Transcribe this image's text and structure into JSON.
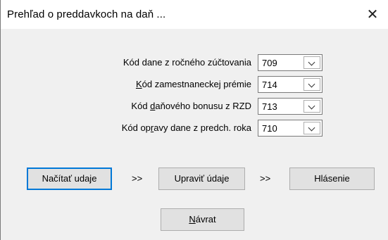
{
  "window": {
    "title": "Prehľad o preddavkoch na daň ...",
    "close_glyph": "✕"
  },
  "fields": [
    {
      "label_pre": "Kód dane z ročného zúčtovania",
      "label_acc": "",
      "label_post": "",
      "value": "709"
    },
    {
      "label_pre": "",
      "label_acc": "K",
      "label_post": "ód zamestnaneckej prémie",
      "value": "714"
    },
    {
      "label_pre": "Kód ",
      "label_acc": "d",
      "label_post": "aňového bonusu z RZD",
      "value": "713"
    },
    {
      "label_pre": "Kód op",
      "label_acc": "r",
      "label_post": "avy dane z predch. roka",
      "value": "710"
    }
  ],
  "actions": {
    "load_label": "Načítať udaje",
    "separator": ">>",
    "edit_label": "Upraviť údaje",
    "report_label": "Hlásenie",
    "back_accel": "N",
    "back_rest": "ávrat"
  },
  "icons": {
    "close": "close-icon",
    "dropdown": "chevron-down-icon"
  }
}
